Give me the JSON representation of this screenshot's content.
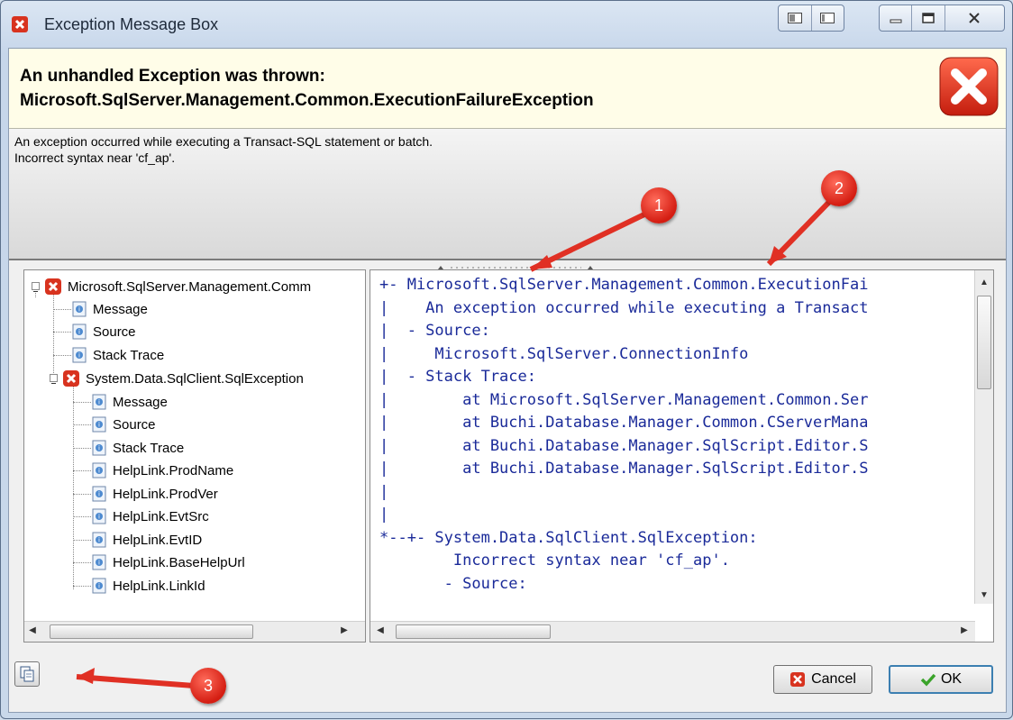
{
  "window": {
    "title": "Exception Message Box",
    "titlebar_buttons": [
      "restore-layout-icon",
      "detail-layout-icon",
      "minimize-icon",
      "maximize-icon",
      "close-icon"
    ]
  },
  "header": {
    "line1": "An unhandled Exception was thrown:",
    "line2": "Microsoft.SqlServer.Management.Common.ExecutionFailureException"
  },
  "message": {
    "line1": "An exception occurred while executing a Transact-SQL statement or batch.",
    "line2": "Incorrect syntax near 'cf_ap'."
  },
  "tree": {
    "nodes": [
      {
        "label": "Microsoft.SqlServer.Management.Comm",
        "icon": "error-icon",
        "level": 0
      },
      {
        "label": "Message",
        "icon": "info-doc-icon",
        "level": 1
      },
      {
        "label": "Source",
        "icon": "info-doc-icon",
        "level": 1
      },
      {
        "label": "Stack Trace",
        "icon": "info-doc-icon",
        "level": 1
      },
      {
        "label": "System.Data.SqlClient.SqlException",
        "icon": "error-icon",
        "level": 1
      },
      {
        "label": "Message",
        "icon": "info-doc-icon",
        "level": 2
      },
      {
        "label": "Source",
        "icon": "info-doc-icon",
        "level": 2
      },
      {
        "label": "Stack Trace",
        "icon": "info-doc-icon",
        "level": 2
      },
      {
        "label": "HelpLink.ProdName",
        "icon": "info-doc-icon",
        "level": 2
      },
      {
        "label": "HelpLink.ProdVer",
        "icon": "info-doc-icon",
        "level": 2
      },
      {
        "label": "HelpLink.EvtSrc",
        "icon": "info-doc-icon",
        "level": 2
      },
      {
        "label": "HelpLink.EvtID",
        "icon": "info-doc-icon",
        "level": 2
      },
      {
        "label": "HelpLink.BaseHelpUrl",
        "icon": "info-doc-icon",
        "level": 2
      },
      {
        "label": "HelpLink.LinkId",
        "icon": "info-doc-icon",
        "level": 2
      }
    ]
  },
  "detail": {
    "lines": [
      "+- Microsoft.SqlServer.Management.Common.ExecutionFai",
      "|    An exception occurred while executing a Transact",
      "|  - Source:",
      "|     Microsoft.SqlServer.ConnectionInfo",
      "|  - Stack Trace:",
      "|        at Microsoft.SqlServer.Management.Common.Ser",
      "|        at Buchi.Database.Manager.Common.CServerMana",
      "|        at Buchi.Database.Manager.SqlScript.Editor.S",
      "|        at Buchi.Database.Manager.SqlScript.Editor.S",
      "|",
      "|",
      "*--+- System.Data.SqlClient.SqlException:",
      "        Incorrect syntax near 'cf_ap'.",
      "       - Source:"
    ]
  },
  "footer": {
    "copy_icon": "copy-icon",
    "cancel_label": "Cancel",
    "ok_label": "OK"
  },
  "callouts": [
    "1",
    "2",
    "3"
  ],
  "colors": {
    "header_bg": "#fffde8",
    "code_text": "#1a2a99",
    "callout_red": "#d41d12",
    "error_red": "#e0301e"
  }
}
